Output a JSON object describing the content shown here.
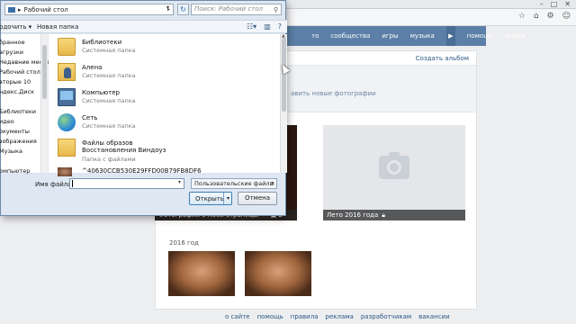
{
  "browser": {
    "window_controls": [
      "–",
      "□",
      "✕"
    ],
    "toolbar_icons": [
      "star-icon",
      "home-icon",
      "settings-icon",
      "smile-icon"
    ]
  },
  "dialog": {
    "address": "Рабочий стол",
    "address_chevron": "▸",
    "search_placeholder": "Поиск: Рабочий стол",
    "organize": "рдочить ▾",
    "new_folder": "Новая папка",
    "nav_items": [
      "бранное",
      "агрузки",
      "Недавние места",
      "Рабочий стол",
      "вторые 10",
      "ндекс.Диск",
      "Библиотеки",
      "идео",
      "окументы",
      "зображения",
      "Музыка",
      "омпьютер"
    ],
    "files": [
      {
        "name": "Библиотеки",
        "type": "Системная папка",
        "icon": "folder"
      },
      {
        "name": "Алена",
        "type": "Системная папка",
        "icon": "user"
      },
      {
        "name": "Компьютер",
        "type": "Системная папка",
        "icon": "computer"
      },
      {
        "name": "Сеть",
        "type": "Системная папка",
        "icon": "network"
      },
      {
        "name": "Файлы образов Восстановления Виндоуз",
        "type": "Папка с файлами",
        "icon": "restore"
      },
      {
        "name": "^40630CCB530E29FFD00B79FB8DF6",
        "type": "",
        "icon": "thumb"
      }
    ],
    "filename_label": "Имя файла:",
    "filename_value": "",
    "filetype": "Пользовательские файлы",
    "open_label": "Открыть",
    "cancel_label": "Отмена"
  },
  "vk": {
    "nav": [
      "то",
      "сообщества",
      "игры",
      "музыка",
      "помощь",
      "выйти"
    ],
    "nav_arrow": "▶",
    "create_album": "Создать альбом",
    "upload_text": "авить новые фотографии",
    "album_a_caption": "Фотографии с моей страницы",
    "album_a_count": "2",
    "album_b_caption": "Лето 2016 года",
    "year_label": "2016 год",
    "footer": [
      "о сайте",
      "помощь",
      "правила",
      "реклама",
      "разработчикам",
      "вакансии"
    ]
  }
}
